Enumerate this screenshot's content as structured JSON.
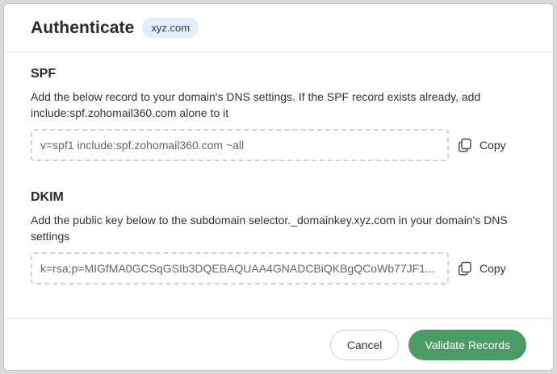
{
  "header": {
    "title": "Authenticate",
    "domain_badge": "xyz.com"
  },
  "spf": {
    "title": "SPF",
    "description": "Add the below record to your domain's DNS settings. If the SPF record exists already, add include:spf.zohomail360.com alone to it",
    "record": "v=spf1 include:spf.zohomail360.com ~all",
    "copy_label": "Copy"
  },
  "dkim": {
    "title": "DKIM",
    "description": "Add the public key below to the subdomain selector._domainkey.xyz.com in your domain's DNS settings",
    "record": "k=rsa;p=MIGfMA0GCSqGSIb3DQEBAQUAA4GNADCBiQKBgQCoWb77JF1...",
    "copy_label": "Copy"
  },
  "footer": {
    "cancel_label": "Cancel",
    "validate_label": "Validate Records"
  },
  "colors": {
    "accent": "#4b9b66",
    "badge_bg": "#e3eefb"
  },
  "icons": {
    "copy": "copy-icon"
  }
}
